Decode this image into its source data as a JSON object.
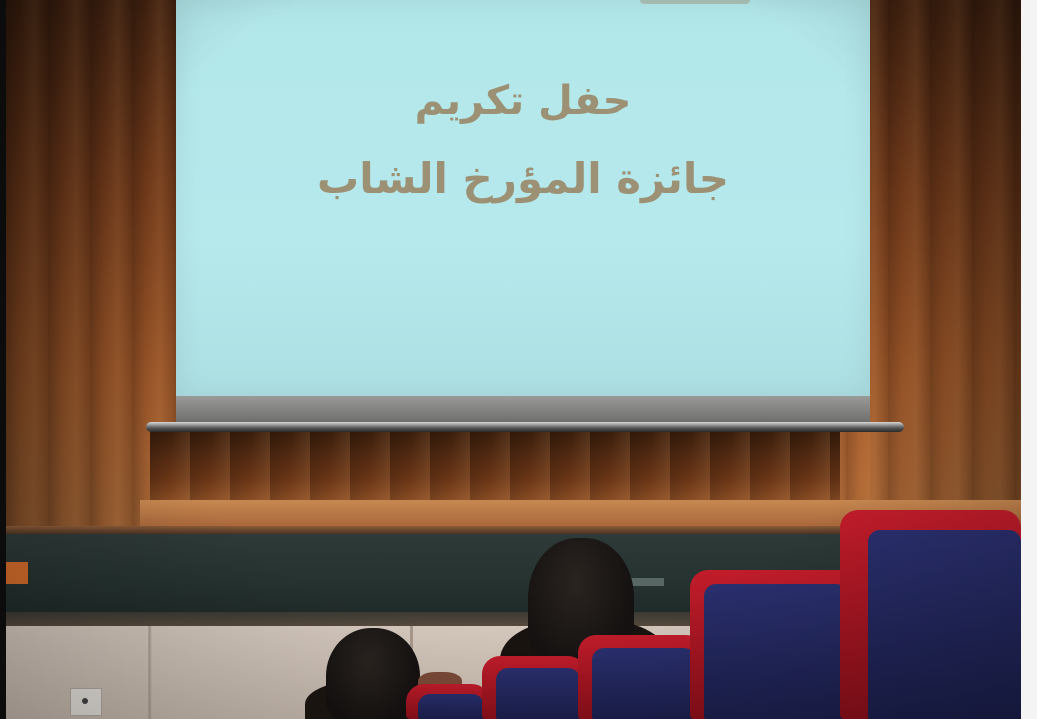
{
  "slide": {
    "line1": "حفل تكريم",
    "line2": "جائزة المؤرخ الشاب"
  },
  "colors": {
    "screen": "#b3e7ea",
    "slide_text": "#9c9175",
    "curtain": "#a45a2a",
    "seat_frame": "#c11c2a",
    "seat_fabric": "#2a2f6e"
  }
}
